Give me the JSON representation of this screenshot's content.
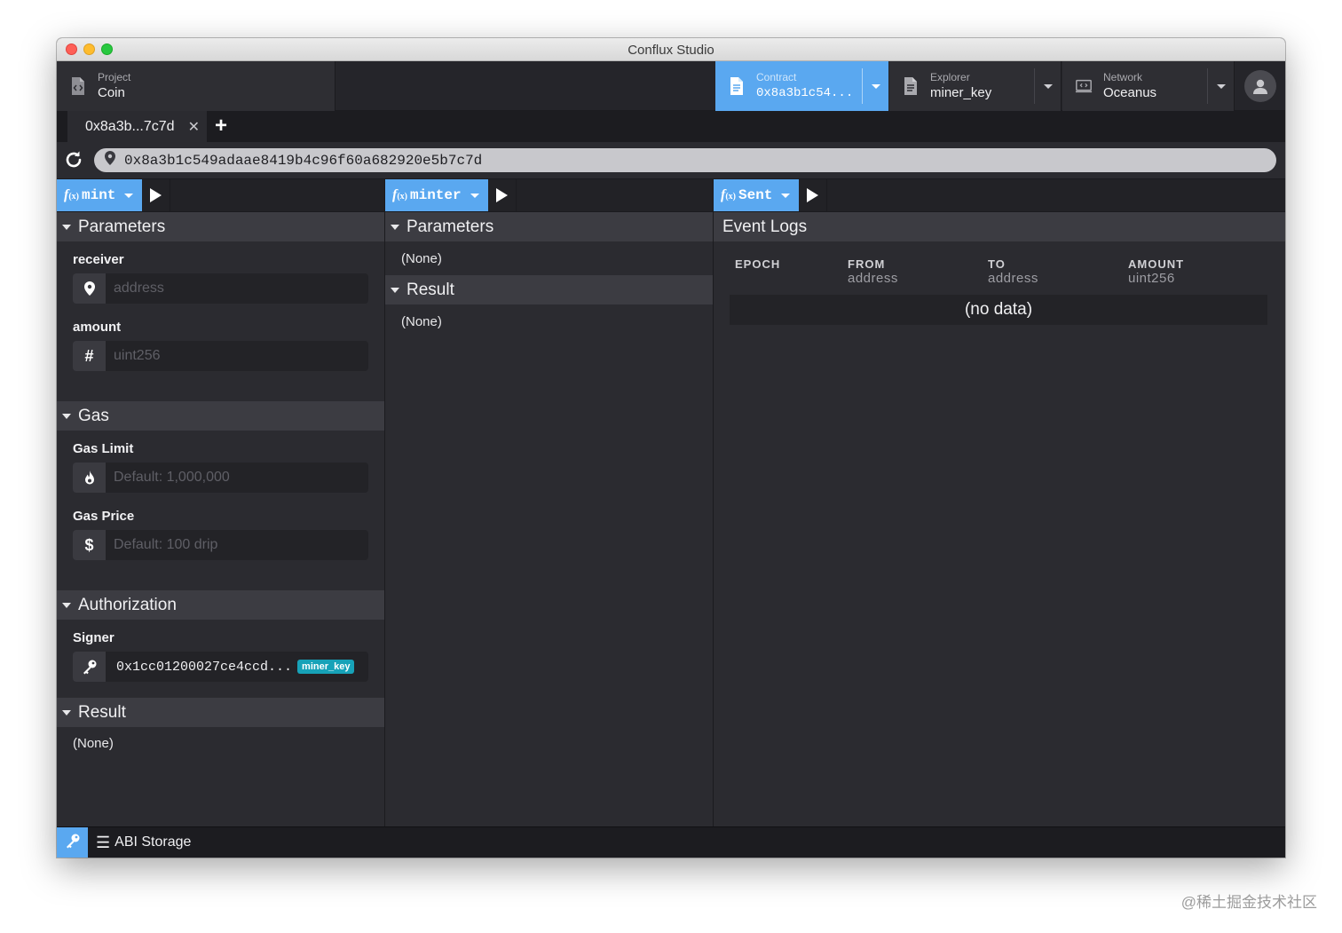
{
  "window": {
    "title": "Conflux Studio"
  },
  "topnav": {
    "project": {
      "caption": "Project",
      "value": "Coin",
      "icon": "code-file-icon"
    },
    "contract": {
      "caption": "Contract",
      "value": "0x8a3b1c54...",
      "icon": "document-icon"
    },
    "explorer": {
      "caption": "Explorer",
      "value": "miner_key",
      "icon": "document-icon"
    },
    "network": {
      "caption": "Network",
      "value": "Oceanus",
      "icon": "network-icon"
    },
    "avatar": "user-avatar-icon"
  },
  "tabs": [
    {
      "label": "0x8a3b...7c7d",
      "close": "✕"
    }
  ],
  "tab_add": "+",
  "address": {
    "value": "0x8a3b1c549adaae8419b4c96f60a682920e5b7c7d"
  },
  "columns": {
    "mint": {
      "fx": "f",
      "fx_sub": "(x)",
      "function": "mint",
      "parameters": {
        "title": "Parameters",
        "receiver": {
          "label": "receiver",
          "placeholder": "address",
          "icon_glyph": ""
        },
        "amount": {
          "label": "amount",
          "placeholder": "uint256",
          "icon_glyph": "#"
        }
      },
      "gas": {
        "title": "Gas",
        "limit": {
          "label": "Gas Limit",
          "placeholder": "Default: 1,000,000"
        },
        "price": {
          "label": "Gas Price",
          "placeholder": "Default: 100 drip",
          "icon_glyph": "$"
        }
      },
      "authorization": {
        "title": "Authorization",
        "signer_label": "Signer",
        "signer_address": "0x1cc01200027ce4ccd...",
        "signer_badge": "miner_key"
      },
      "result": {
        "title": "Result",
        "value": "(None)"
      }
    },
    "minter": {
      "fx": "f",
      "fx_sub": "(x)",
      "function": "minter",
      "parameters": {
        "title": "Parameters",
        "value": "(None)"
      },
      "result": {
        "title": "Result",
        "value": "(None)"
      }
    },
    "sent": {
      "fx": "f",
      "fx_sub": "(x)",
      "function": "Sent",
      "event_logs": {
        "title": "Event Logs",
        "columns": [
          {
            "name": "EPOCH",
            "type": ""
          },
          {
            "name": "FROM",
            "type": "address"
          },
          {
            "name": "TO",
            "type": "address"
          },
          {
            "name": "AMOUNT",
            "type": "uint256"
          }
        ],
        "empty": "(no data)"
      }
    }
  },
  "statusbar": {
    "abi_storage": "ABI Storage",
    "abi_icon": "☰"
  },
  "watermark": "@稀土掘金技术社区",
  "colors": {
    "accent": "#5aa8f0",
    "badge": "#17a2b8",
    "bg": "#2b2b30"
  }
}
